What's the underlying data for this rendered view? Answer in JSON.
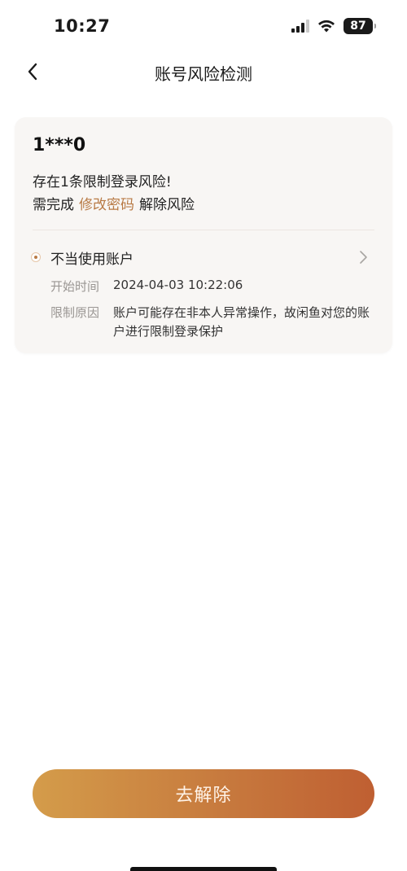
{
  "status_bar": {
    "time": "10:27",
    "battery_level": "87",
    "icons": [
      "signal-icon",
      "wifi-icon",
      "battery-icon"
    ]
  },
  "nav": {
    "title": "账号风险检测",
    "back_icon": "chevron-left-icon"
  },
  "card": {
    "account_id": "1***0",
    "summary": "存在1条限制登录风险!",
    "action_prefix": "需完成",
    "action_link": "修改密码",
    "action_suffix": "解除风险",
    "risk_item": {
      "title": "不当使用账户",
      "start_label": "开始时间",
      "start_value": "2024-04-03 10:22:06",
      "reason_label": "限制原因",
      "reason_value": "账户可能存在非本人异常操作，故闲鱼对您的账户进行限制登录保护"
    }
  },
  "footer": {
    "resolve_button": "去解除"
  },
  "colors": {
    "accent_link": "#b87a45",
    "button_gradient_start": "#d49c4a",
    "button_gradient_end": "#bf5f32",
    "card_background": "#f8f6f4"
  }
}
